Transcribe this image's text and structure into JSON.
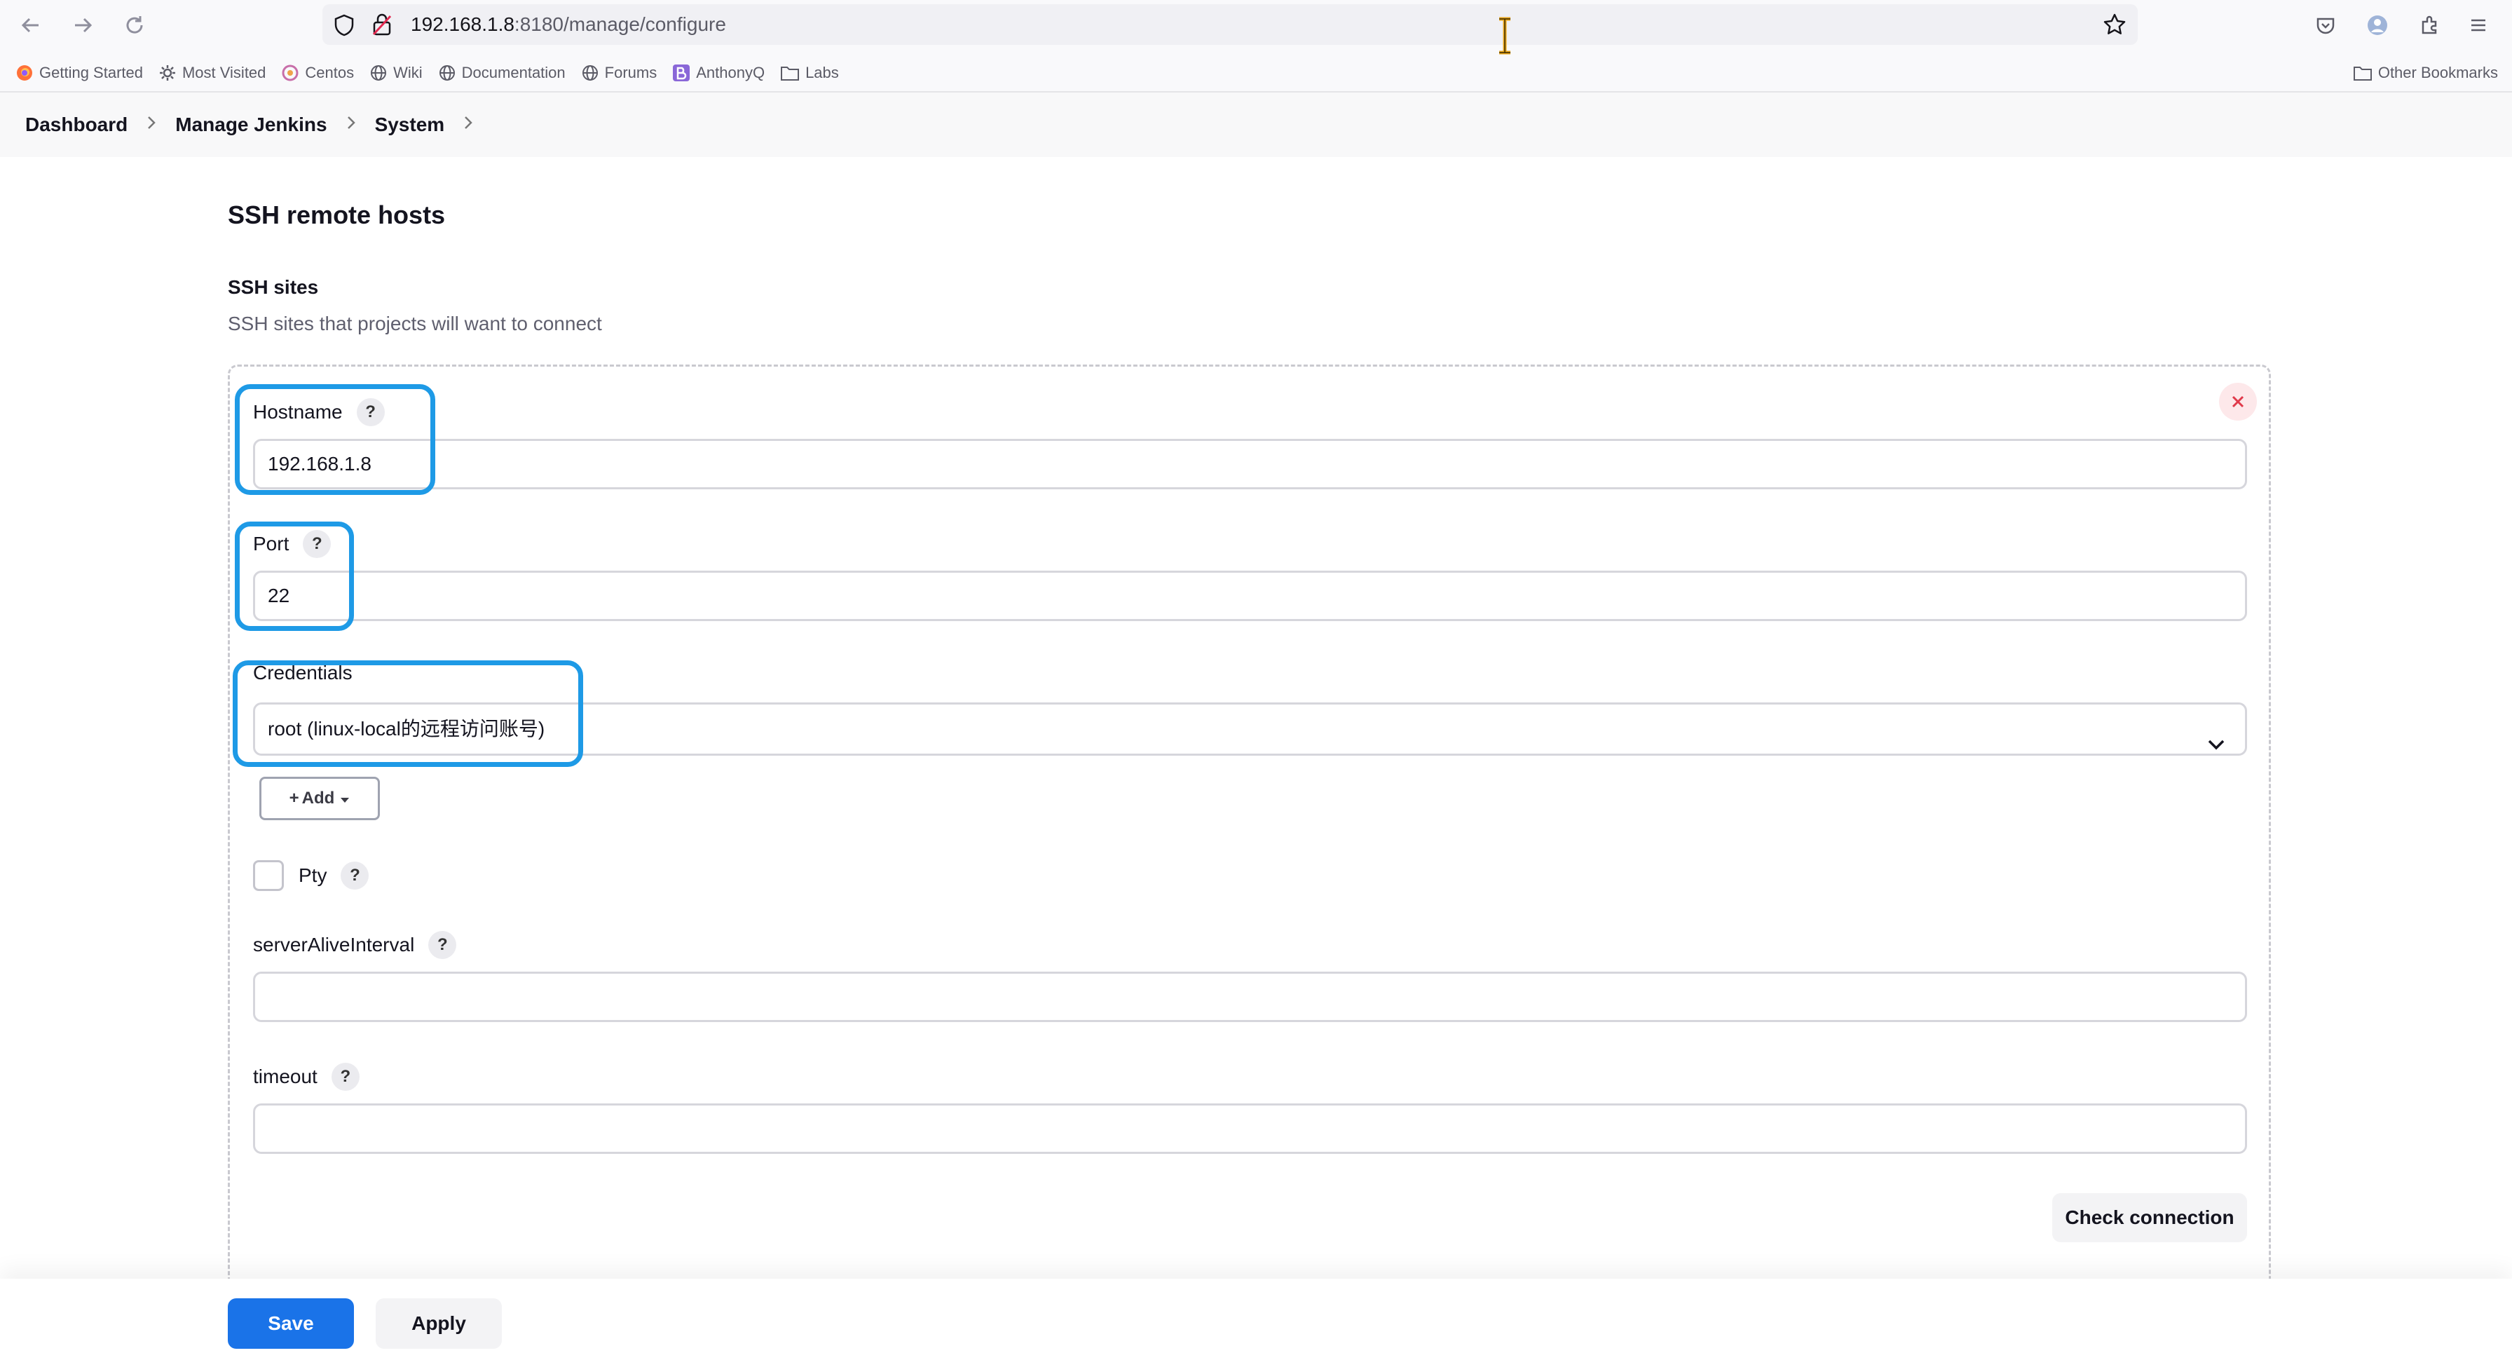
{
  "browser": {
    "url_host": "192.168.1.8",
    "url_rest": ":8180/manage/configure",
    "bookmarks": [
      {
        "label": "Getting Started",
        "icon": "firefox-icon"
      },
      {
        "label": "Most Visited",
        "icon": "gear-icon"
      },
      {
        "label": "Centos",
        "icon": "centos-icon"
      },
      {
        "label": "Wiki",
        "icon": "globe-icon"
      },
      {
        "label": "Documentation",
        "icon": "globe-icon"
      },
      {
        "label": "Forums",
        "icon": "globe-icon"
      },
      {
        "label": "AnthonyQ",
        "icon": "b-icon"
      },
      {
        "label": "Labs",
        "icon": "folder-icon"
      }
    ],
    "other_bookmarks": "Other Bookmarks"
  },
  "breadcrumbs": [
    "Dashboard",
    "Manage Jenkins",
    "System"
  ],
  "section": {
    "title": "SSH remote hosts",
    "field_title": "SSH sites",
    "field_desc": "SSH sites that projects will want to connect"
  },
  "form": {
    "hostname_label": "Hostname",
    "hostname_value": "192.168.1.8",
    "port_label": "Port",
    "port_value": "22",
    "credentials_label": "Credentials",
    "credentials_value": "root (linux-local的远程访问账号)",
    "add_label": "Add",
    "pty_label": "Pty",
    "server_alive_label": "serverAliveInterval",
    "server_alive_value": "",
    "timeout_label": "timeout",
    "timeout_value": "",
    "check_connection": "Check connection",
    "help_glyph": "?"
  },
  "footer": {
    "save": "Save",
    "apply": "Apply"
  },
  "colors": {
    "primary": "#1a73e8",
    "highlight": "#1e9ae6",
    "close": "#e03a4b"
  }
}
